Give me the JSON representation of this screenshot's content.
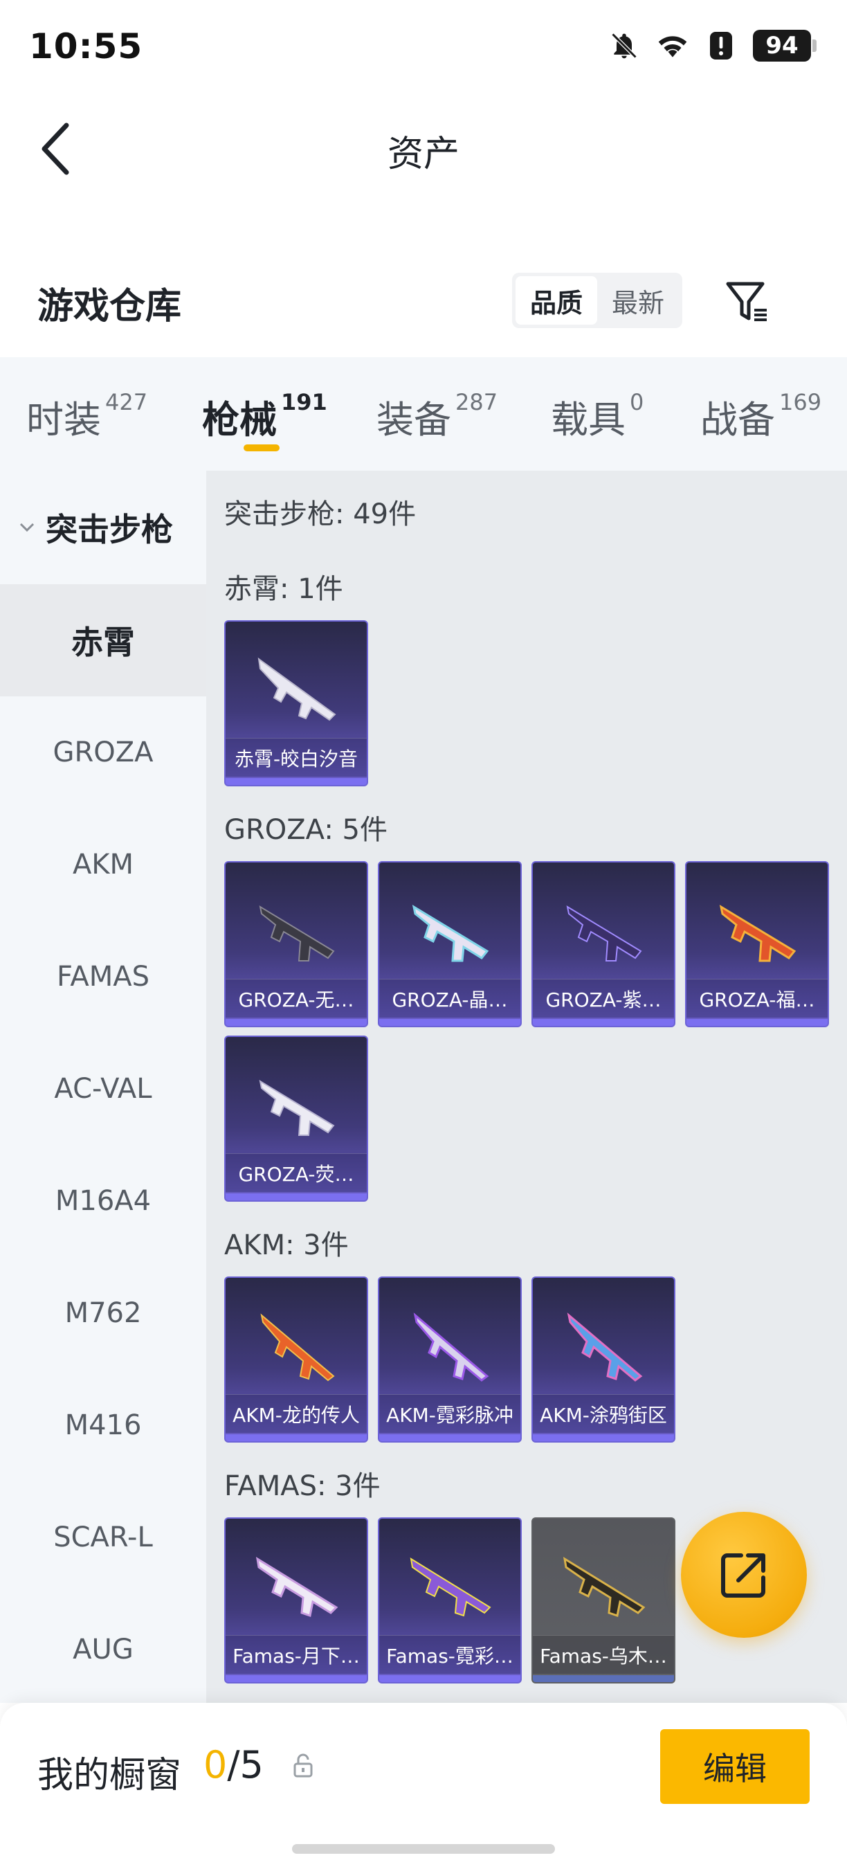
{
  "status_bar": {
    "time": "10:55",
    "battery": "94"
  },
  "header": {
    "title": "资产"
  },
  "warehouse": {
    "title": "游戏仓库",
    "sort_options": [
      "品质",
      "最新"
    ],
    "active_sort": "品质"
  },
  "tabs": [
    {
      "label": "时装",
      "count": "427"
    },
    {
      "label": "枪械",
      "count": "191"
    },
    {
      "label": "装备",
      "count": "287"
    },
    {
      "label": "载具",
      "count": "0"
    },
    {
      "label": "战备",
      "count": "169"
    }
  ],
  "active_tab": "枪械",
  "sidebar": {
    "group": "突击步枪",
    "items": [
      "赤霄",
      "GROZA",
      "AKM",
      "FAMAS",
      "AC-VAL",
      "M16A4",
      "M762",
      "M416",
      "SCAR-L",
      "AUG"
    ],
    "active_item": "赤霄"
  },
  "content": {
    "total_header": "突击步枪: 49件",
    "sections": [
      {
        "header": "赤霄: 1件",
        "cards": [
          {
            "name": "赤霄-皎白汐音"
          }
        ]
      },
      {
        "header": "GROZA: 5件",
        "cards": [
          {
            "name": "GROZA-无…"
          },
          {
            "name": "GROZA-晶…"
          },
          {
            "name": "GROZA-紫…"
          },
          {
            "name": "GROZA-福…"
          },
          {
            "name": "GROZA-荧…"
          }
        ]
      },
      {
        "header": "AKM: 3件",
        "cards": [
          {
            "name": "AKM-龙的传人"
          },
          {
            "name": "AKM-霓彩脉冲"
          },
          {
            "name": "AKM-涂鸦街区"
          }
        ]
      },
      {
        "header": "FAMAS: 3件",
        "cards": [
          {
            "name": "Famas-月下…"
          },
          {
            "name": "Famas-霓彩…"
          },
          {
            "name": "Famas-乌木…"
          }
        ]
      }
    ]
  },
  "bottom_bar": {
    "showcase_label": "我的橱窗",
    "showcase_current": "0",
    "showcase_total": "/5",
    "edit_label": "编辑"
  },
  "colors": {
    "accent": "#f4b400",
    "card_purple": "#6c63d6",
    "tabs_bg": "#f4f7fa",
    "content_bg": "#e8ebee"
  },
  "icons": [
    "bell-muted-icon",
    "wifi-icon",
    "alert-icon",
    "battery-icon",
    "back-icon",
    "filter-icon",
    "expand-down-icon",
    "share-icon",
    "lock-icon"
  ]
}
